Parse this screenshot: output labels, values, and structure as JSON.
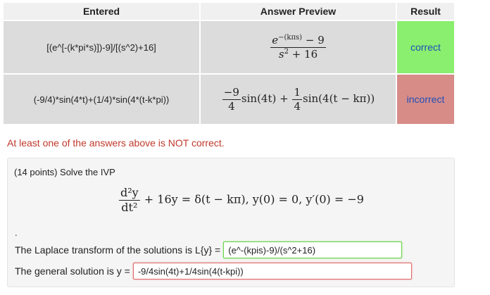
{
  "table": {
    "headers": [
      "Entered",
      "Answer Preview",
      "Result"
    ],
    "rows": [
      {
        "entered": "[(e^[-(k*pi*s)])-9]/[(s^2)+16]",
        "result": "correct",
        "preview": {
          "num_base": "e",
          "num_exp": "−(kπs)",
          "num_tail": " − 9",
          "den": "s",
          "den_sup": "2",
          "den_tail": " + 16"
        }
      },
      {
        "entered": "(-9/4)*sin(4*t)+(1/4)*sin(4*(t-k*pi))",
        "result": "incorrect",
        "preview": {
          "f1_num": "−9",
          "f1_den": "4",
          "term1": "sin(4t) + ",
          "f2_num": "1",
          "f2_den": "4",
          "term2": "sin(4(t − kπ))"
        }
      }
    ]
  },
  "warning": "At least one of the answers above is NOT correct.",
  "problem": {
    "intro": "(14 points) Solve the IVP",
    "eq_num": "d²y",
    "eq_den": "dt²",
    "eq_rest": " + 16y = δ(t − kπ), y(0) = 0, y′(0) = −9",
    "dot": ".",
    "q1_label": "The Laplace transform of the solutions is L{y} = ",
    "q1_answer": "(e^-(kpis)-9)/(s^2+16)",
    "q2_label": "The general solution is y = ",
    "q2_answer": "-9/4sin(4t)+1/4sin(4(t-kpi))"
  },
  "colors": {
    "correct": "#8aee6f",
    "incorrect": "#d78c88",
    "warning": "#c0392b"
  }
}
